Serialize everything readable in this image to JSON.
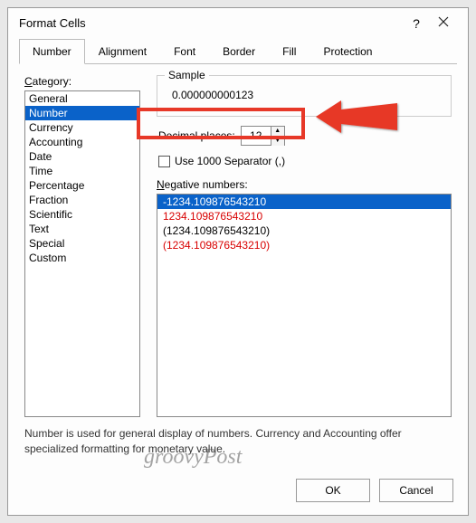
{
  "title": "Format Cells",
  "tabs": [
    "Number",
    "Alignment",
    "Font",
    "Border",
    "Fill",
    "Protection"
  ],
  "active_tab": 0,
  "category_label": "Category:",
  "categories": [
    "General",
    "Number",
    "Currency",
    "Accounting",
    "Date",
    "Time",
    "Percentage",
    "Fraction",
    "Scientific",
    "Text",
    "Special",
    "Custom"
  ],
  "selected_category": 1,
  "sample_label": "Sample",
  "sample_value": "0.000000000123",
  "decimal_label": "Decimal places:",
  "decimal_value": "12",
  "separator_label": "Use 1000 Separator (,)",
  "negative_label": "Negative numbers:",
  "negative_items": [
    {
      "text": "-1234.109876543210",
      "red": false,
      "sel": true
    },
    {
      "text": "1234.109876543210",
      "red": true,
      "sel": false
    },
    {
      "text": "(1234.109876543210)",
      "red": false,
      "sel": false
    },
    {
      "text": "(1234.109876543210)",
      "red": true,
      "sel": false
    }
  ],
  "description": "Number is used for general display of numbers.  Currency and Accounting offer specialized formatting for monetary value.",
  "ok": "OK",
  "cancel": "Cancel",
  "watermark": "groovyPost",
  "highlight_color": "#e73828"
}
